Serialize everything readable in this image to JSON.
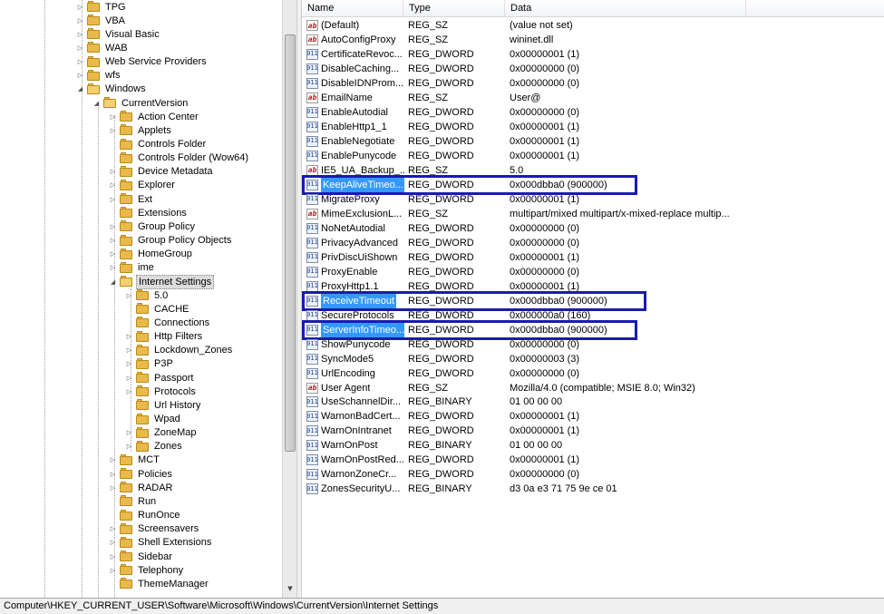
{
  "tree": {
    "items": [
      {
        "label": "TPG",
        "depth": 0,
        "expander": "▷"
      },
      {
        "label": "VBA",
        "depth": 0,
        "expander": "▷"
      },
      {
        "label": "Visual Basic",
        "depth": 0,
        "expander": "▷"
      },
      {
        "label": "WAB",
        "depth": 0,
        "expander": "▷"
      },
      {
        "label": "Web Service Providers",
        "depth": 0,
        "expander": "▷"
      },
      {
        "label": "wfs",
        "depth": 0,
        "expander": "▷"
      },
      {
        "label": "Windows",
        "depth": 0,
        "expander": "◢"
      },
      {
        "label": "CurrentVersion",
        "depth": 1,
        "expander": "◢"
      },
      {
        "label": "Action Center",
        "depth": 2,
        "expander": "▷"
      },
      {
        "label": "Applets",
        "depth": 2,
        "expander": "▷"
      },
      {
        "label": "Controls Folder",
        "depth": 2,
        "expander": ""
      },
      {
        "label": "Controls Folder (Wow64)",
        "depth": 2,
        "expander": ""
      },
      {
        "label": "Device Metadata",
        "depth": 2,
        "expander": "▷"
      },
      {
        "label": "Explorer",
        "depth": 2,
        "expander": "▷"
      },
      {
        "label": "Ext",
        "depth": 2,
        "expander": "▷"
      },
      {
        "label": "Extensions",
        "depth": 2,
        "expander": ""
      },
      {
        "label": "Group Policy",
        "depth": 2,
        "expander": "▷"
      },
      {
        "label": "Group Policy Objects",
        "depth": 2,
        "expander": "▷"
      },
      {
        "label": "HomeGroup",
        "depth": 2,
        "expander": "▷"
      },
      {
        "label": "ime",
        "depth": 2,
        "expander": "▷"
      },
      {
        "label": "Internet Settings",
        "depth": 2,
        "expander": "◢",
        "selected": true
      },
      {
        "label": "5.0",
        "depth": 3,
        "expander": "▷"
      },
      {
        "label": "CACHE",
        "depth": 3,
        "expander": ""
      },
      {
        "label": "Connections",
        "depth": 3,
        "expander": ""
      },
      {
        "label": "Http Filters",
        "depth": 3,
        "expander": "▷"
      },
      {
        "label": "Lockdown_Zones",
        "depth": 3,
        "expander": "▷"
      },
      {
        "label": "P3P",
        "depth": 3,
        "expander": "▷"
      },
      {
        "label": "Passport",
        "depth": 3,
        "expander": "▷"
      },
      {
        "label": "Protocols",
        "depth": 3,
        "expander": "▷"
      },
      {
        "label": "Url History",
        "depth": 3,
        "expander": ""
      },
      {
        "label": "Wpad",
        "depth": 3,
        "expander": ""
      },
      {
        "label": "ZoneMap",
        "depth": 3,
        "expander": "▷"
      },
      {
        "label": "Zones",
        "depth": 3,
        "expander": "▷"
      },
      {
        "label": "MCT",
        "depth": 2,
        "expander": "▷"
      },
      {
        "label": "Policies",
        "depth": 2,
        "expander": "▷"
      },
      {
        "label": "RADAR",
        "depth": 2,
        "expander": "▷"
      },
      {
        "label": "Run",
        "depth": 2,
        "expander": ""
      },
      {
        "label": "RunOnce",
        "depth": 2,
        "expander": ""
      },
      {
        "label": "Screensavers",
        "depth": 2,
        "expander": "▷"
      },
      {
        "label": "Shell Extensions",
        "depth": 2,
        "expander": "▷"
      },
      {
        "label": "Sidebar",
        "depth": 2,
        "expander": "▷"
      },
      {
        "label": "Telephony",
        "depth": 2,
        "expander": "▷"
      },
      {
        "label": "ThemeManager",
        "depth": 2,
        "expander": ""
      }
    ]
  },
  "list": {
    "columns": {
      "name": "Name",
      "type": "Type",
      "data": "Data"
    },
    "rows": [
      {
        "name": "(Default)",
        "type": "REG_SZ",
        "data": "(value not set)",
        "icon": "string-value-icon"
      },
      {
        "name": "AutoConfigProxy",
        "type": "REG_SZ",
        "data": "wininet.dll",
        "icon": "string-value-icon"
      },
      {
        "name": "CertificateRevoc...",
        "type": "REG_DWORD",
        "data": "0x00000001 (1)",
        "icon": "binary-value-icon"
      },
      {
        "name": "DisableCaching...",
        "type": "REG_DWORD",
        "data": "0x00000000 (0)",
        "icon": "binary-value-icon"
      },
      {
        "name": "DisableIDNProm...",
        "type": "REG_DWORD",
        "data": "0x00000000 (0)",
        "icon": "binary-value-icon"
      },
      {
        "name": "EmailName",
        "type": "REG_SZ",
        "data": "User@",
        "icon": "string-value-icon"
      },
      {
        "name": "EnableAutodial",
        "type": "REG_DWORD",
        "data": "0x00000000 (0)",
        "icon": "binary-value-icon"
      },
      {
        "name": "EnableHttp1_1",
        "type": "REG_DWORD",
        "data": "0x00000001 (1)",
        "icon": "binary-value-icon"
      },
      {
        "name": "EnableNegotiate",
        "type": "REG_DWORD",
        "data": "0x00000001 (1)",
        "icon": "binary-value-icon"
      },
      {
        "name": "EnablePunycode",
        "type": "REG_DWORD",
        "data": "0x00000001 (1)",
        "icon": "binary-value-icon"
      },
      {
        "name": "IE5_UA_Backup_...",
        "type": "REG_SZ",
        "data": "5.0",
        "icon": "string-value-icon"
      },
      {
        "name": "KeepAliveTimeo...",
        "type": "REG_DWORD",
        "data": "0x000dbba0 (900000)",
        "icon": "binary-value-icon",
        "selected": true,
        "boxed": true
      },
      {
        "name": "MigrateProxy",
        "type": "REG_DWORD",
        "data": "0x00000001 (1)",
        "icon": "binary-value-icon"
      },
      {
        "name": "MimeExclusionL...",
        "type": "REG_SZ",
        "data": "multipart/mixed multipart/x-mixed-replace multip...",
        "icon": "string-value-icon"
      },
      {
        "name": "NoNetAutodial",
        "type": "REG_DWORD",
        "data": "0x00000000 (0)",
        "icon": "binary-value-icon"
      },
      {
        "name": "PrivacyAdvanced",
        "type": "REG_DWORD",
        "data": "0x00000000 (0)",
        "icon": "binary-value-icon"
      },
      {
        "name": "PrivDiscUiShown",
        "type": "REG_DWORD",
        "data": "0x00000001 (1)",
        "icon": "binary-value-icon"
      },
      {
        "name": "ProxyEnable",
        "type": "REG_DWORD",
        "data": "0x00000000 (0)",
        "icon": "binary-value-icon"
      },
      {
        "name": "ProxyHttp1.1",
        "type": "REG_DWORD",
        "data": "0x00000001 (1)",
        "icon": "binary-value-icon"
      },
      {
        "name": "ReceiveTimeout",
        "type": "REG_DWORD",
        "data": "0x000dbba0 (900000)",
        "icon": "binary-value-icon",
        "selected": true,
        "boxed": true
      },
      {
        "name": "SecureProtocols",
        "type": "REG_DWORD",
        "data": "0x000000a0 (160)",
        "icon": "binary-value-icon"
      },
      {
        "name": "ServerInfoTimeo...",
        "type": "REG_DWORD",
        "data": "0x000dbba0 (900000)",
        "icon": "binary-value-icon",
        "selected": true,
        "boxed": true
      },
      {
        "name": "ShowPunycode",
        "type": "REG_DWORD",
        "data": "0x00000000 (0)",
        "icon": "binary-value-icon"
      },
      {
        "name": "SyncMode5",
        "type": "REG_DWORD",
        "data": "0x00000003 (3)",
        "icon": "binary-value-icon"
      },
      {
        "name": "UrlEncoding",
        "type": "REG_DWORD",
        "data": "0x00000000 (0)",
        "icon": "binary-value-icon"
      },
      {
        "name": "User Agent",
        "type": "REG_SZ",
        "data": "Mozilla/4.0 (compatible; MSIE 8.0; Win32)",
        "icon": "string-value-icon"
      },
      {
        "name": "UseSchannelDir...",
        "type": "REG_BINARY",
        "data": "01 00 00 00",
        "icon": "binary-value-icon"
      },
      {
        "name": "WarnonBadCert...",
        "type": "REG_DWORD",
        "data": "0x00000001 (1)",
        "icon": "binary-value-icon"
      },
      {
        "name": "WarnOnIntranet",
        "type": "REG_DWORD",
        "data": "0x00000001 (1)",
        "icon": "binary-value-icon"
      },
      {
        "name": "WarnOnPost",
        "type": "REG_BINARY",
        "data": "01 00 00 00",
        "icon": "binary-value-icon"
      },
      {
        "name": "WarnOnPostRed...",
        "type": "REG_DWORD",
        "data": "0x00000001 (1)",
        "icon": "binary-value-icon"
      },
      {
        "name": "WarnonZoneCr...",
        "type": "REG_DWORD",
        "data": "0x00000000 (0)",
        "icon": "binary-value-icon"
      },
      {
        "name": "ZonesSecurityU...",
        "type": "REG_BINARY",
        "data": "d3 0a e3 71 75 9e ce 01",
        "icon": "binary-value-icon"
      }
    ]
  },
  "status": {
    "path": "Computer\\HKEY_CURRENT_USER\\Software\\Microsoft\\Windows\\CurrentVersion\\Internet Settings"
  },
  "icons": {
    "string_glyph": "ab",
    "binary_glyph": "011"
  },
  "colors": {
    "selection": "#3399ff",
    "annotation_box": "#1a1ab0",
    "folder": "#e9b949"
  }
}
